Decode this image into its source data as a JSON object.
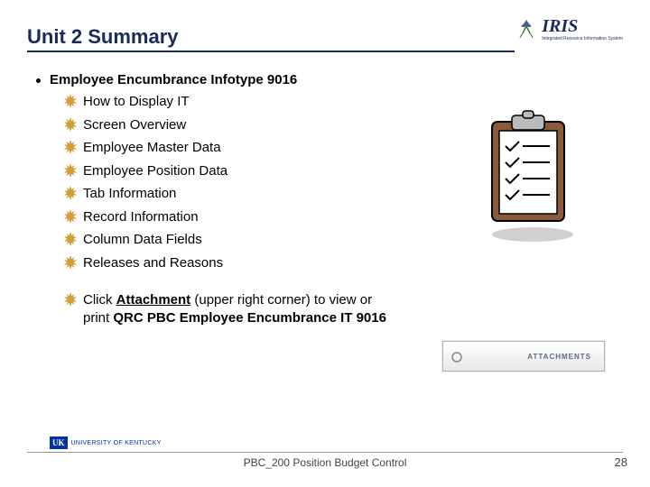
{
  "title": "Unit 2 Summary",
  "logo": {
    "iris": "IRIS",
    "sub": "Integrated Resource Information System"
  },
  "main_bullet": "Employee Encumbrance Infotype 9016",
  "sub_items": [
    "How to Display IT",
    "Screen Overview",
    "Employee Master Data",
    "Employee Position Data",
    "Tab Information",
    "Record Information",
    "Column Data Fields",
    "Releases and Reasons"
  ],
  "attach_pre": "Click ",
  "attach_bold1": "Attachment",
  "attach_mid": " (upper right corner) to view or print ",
  "attach_bold2": "QRC PBC Employee Encumbrance IT 9016",
  "attachments_label": "ATTACHMENTS",
  "footer": {
    "uk_mark": "UK",
    "uk_text": "UNIVERSITY OF KENTUCKY",
    "center": "PBC_200 Position Budget Control",
    "page": "28"
  }
}
